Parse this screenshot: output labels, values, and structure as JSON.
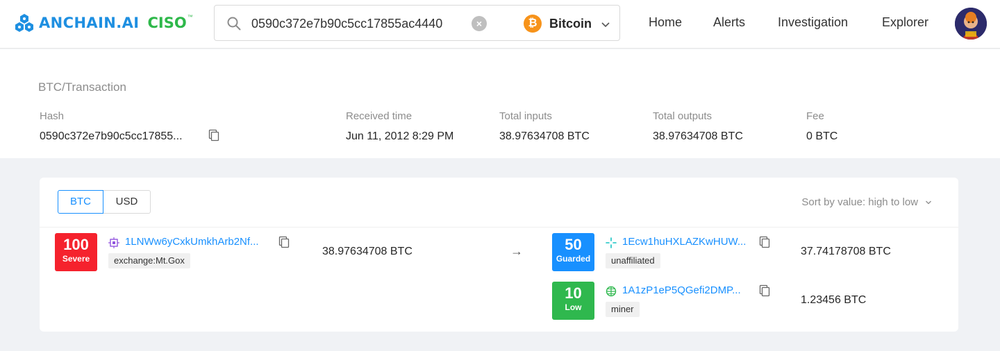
{
  "brand": {
    "name": "ANCHAIN.AI",
    "product": "CISO",
    "trademark": "™"
  },
  "search": {
    "value": "0590c372e7b90c5cc17855ac4440",
    "chain": "Bitcoin"
  },
  "nav": {
    "items": [
      "Home",
      "Alerts",
      "Investigation",
      "Explorer"
    ]
  },
  "transaction": {
    "breadcrumb": "BTC/Transaction",
    "hash_label": "Hash",
    "hash_value": "0590c372e7b90c5cc17855...",
    "received_label": "Received time",
    "received_value": "Jun 11, 2012 8:29 PM",
    "inputs_label": "Total inputs",
    "inputs_value": "38.97634708 BTC",
    "outputs_label": "Total outputs",
    "outputs_value": "38.97634708 BTC",
    "fee_label": "Fee",
    "fee_value": "0 BTC"
  },
  "flow": {
    "currency_options": [
      "BTC",
      "USD"
    ],
    "selected_currency": "BTC",
    "sort_label": "Sort by value: high to low",
    "arrow": "→",
    "inputs": [
      {
        "score": "100",
        "level": "Severe",
        "address": "1LNWw6yCxkUmkhArb2Nf...",
        "tag": "exchange:Mt.Gox",
        "amount": "38.97634708 BTC",
        "icon": "exchange-icon"
      }
    ],
    "outputs": [
      {
        "score": "50",
        "level": "Guarded",
        "address": "1Ecw1huHXLAZKwHUW...",
        "tag": "unaffiliated",
        "amount": "37.74178708 BTC",
        "icon": "unaffiliated-icon"
      },
      {
        "score": "10",
        "level": "Low",
        "address": "1A1zP1eP5QGefi2DMP...",
        "tag": "miner",
        "amount": "1.23456 BTC",
        "icon": "miner-icon"
      }
    ]
  },
  "colors": {
    "brand_blue": "#1e8fe1",
    "brand_green": "#2eb84a",
    "link": "#1890ff",
    "severe": "#f5222d",
    "guarded": "#1890ff",
    "low": "#2fb84e",
    "bitcoin": "#f7931a"
  }
}
